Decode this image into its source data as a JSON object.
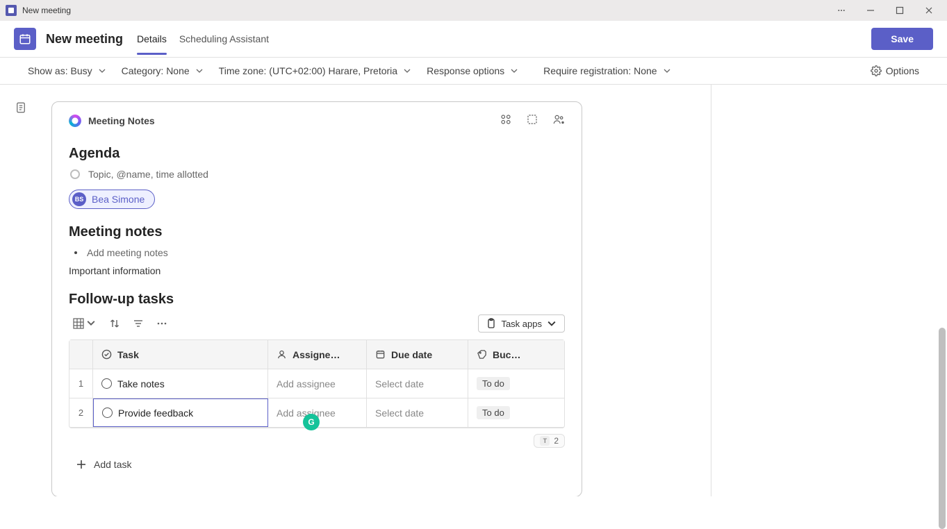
{
  "titlebar": {
    "title": "New meeting"
  },
  "header": {
    "meeting_title": "New meeting",
    "tabs": [
      {
        "label": "Details",
        "active": true
      },
      {
        "label": "Scheduling Assistant",
        "active": false
      }
    ],
    "save_label": "Save"
  },
  "optionsbar": {
    "show_as": "Show as: Busy",
    "category": "Category: None",
    "timezone": "Time zone: (UTC+02:00) Harare, Pretoria",
    "response": "Response options",
    "registration": "Require registration: None",
    "options_label": "Options"
  },
  "notes": {
    "component_title": "Meeting Notes",
    "agenda_heading": "Agenda",
    "agenda_placeholder": "Topic, @name, time allotted",
    "mention": {
      "initials": "BS",
      "name": "Bea Simone"
    },
    "meeting_notes_heading": "Meeting notes",
    "meeting_notes_placeholder": "Add meeting notes",
    "plain_note": "Important information",
    "followup_heading": "Follow-up tasks",
    "task_apps_label": "Task apps",
    "columns": {
      "task": "Task",
      "assignee": "Assigne…",
      "due": "Due date",
      "bucket": "Buc…"
    },
    "rows": [
      {
        "num": "1",
        "task": "Take notes",
        "assignee_ph": "Add assignee",
        "due_ph": "Select date",
        "status": "To do"
      },
      {
        "num": "2",
        "task": "Provide feedback",
        "assignee_ph": "Add assignee",
        "due_ph": "Select date",
        "status": "To do"
      }
    ],
    "count_badge": "2",
    "add_task_label": "Add task"
  }
}
